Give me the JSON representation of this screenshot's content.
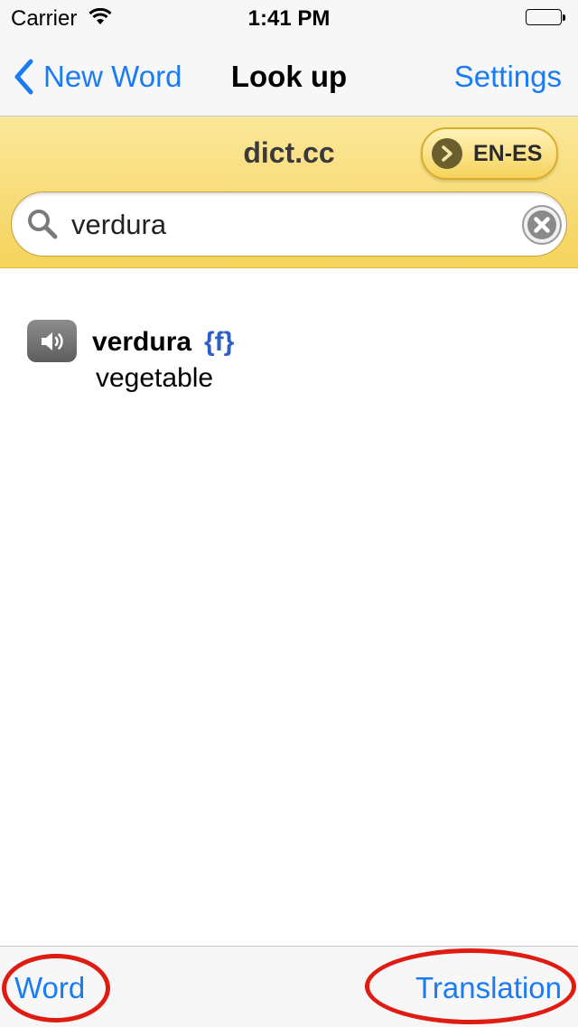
{
  "status_bar": {
    "carrier": "Carrier",
    "time": "1:41 PM",
    "wifi_icon": "wifi-icon",
    "battery_icon": "battery-icon"
  },
  "nav": {
    "back_label": "New Word",
    "title": "Look up",
    "settings_label": "Settings"
  },
  "dictionary": {
    "source": "dict.cc",
    "language_pair": "EN-ES"
  },
  "search": {
    "value": "verdura",
    "icon": "search-icon",
    "clear_icon": "clear-icon"
  },
  "results": [
    {
      "word": "verdura",
      "gender": "{f}",
      "translation": "vegetable",
      "icon": "speaker-icon"
    }
  ],
  "toolbar": {
    "word_label": "Word",
    "translation_label": "Translation"
  },
  "colors": {
    "accent": "#1a7cf5",
    "panel_yellow": "#f8dc78",
    "gender_blue": "#2f5fc4",
    "annotation_red": "#e01b12"
  }
}
